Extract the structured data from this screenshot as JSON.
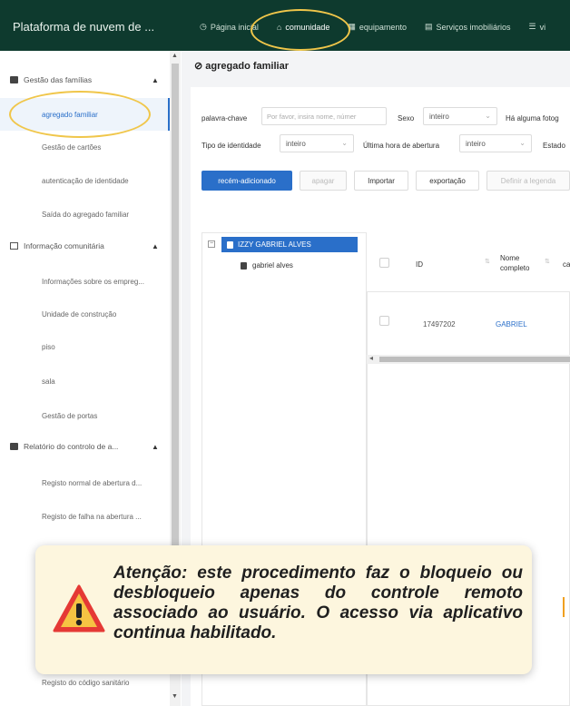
{
  "topbar": {
    "brand": "Plataforma de nuvem de ...",
    "nav": [
      {
        "label": "Página inicial",
        "icon": "clock-icon"
      },
      {
        "label": "comunidade",
        "icon": "home-icon"
      },
      {
        "label": "equipamento",
        "icon": "device-icon"
      },
      {
        "label": "Serviços imobiliários",
        "icon": "building-icon"
      },
      {
        "label": "vi",
        "icon": "list-icon"
      }
    ]
  },
  "sidebar": {
    "groups": [
      {
        "label": "Gestão das famílias",
        "icon": "family-icon"
      },
      {
        "label": "Informação comunitária",
        "icon": "house-icon"
      },
      {
        "label": "Relatório do controlo de a...",
        "icon": "report-icon"
      }
    ],
    "items": [
      "agregado familiar",
      "Gestão de cartões",
      "autenticação de identidade",
      "Saída do agregado familiar",
      "Informações sobre os empreg...",
      "Unidade de construção",
      "piso",
      "sala",
      "Gestão de portas",
      "Registo normal de abertura d...",
      "Registo de falha na abertura ...",
      "Registo do código sanitário"
    ]
  },
  "page": {
    "title": "agregado familiar"
  },
  "filters": {
    "keyword_label": "palavra-chave",
    "keyword_placeholder": "Por favor, insira nome, númer",
    "sex_label": "Sexo",
    "sex_value": "inteiro",
    "photo_label": "Há alguma fotog",
    "identity_label": "Tipo de identidade",
    "identity_value": "inteiro",
    "last_open_label": "Última hora de abertura",
    "last_open_value": "inteiro",
    "state_label": "Estado"
  },
  "toolbar": {
    "add": "recém-adicionado",
    "delete": "apagar",
    "import": "Importar",
    "export": "exportação",
    "caption": "Definir a legenda"
  },
  "tree": {
    "root": "IZZY GABRIEL ALVES",
    "child": "gabriel alves"
  },
  "table": {
    "headers": [
      "ID",
      "Nome completo",
      "ca"
    ],
    "rows": [
      {
        "id": "17497202",
        "name": "GABRIEL"
      }
    ]
  },
  "notice": {
    "text": "Atenção: este procedimento faz o bloqueio ou desbloqueio apenas do controle remoto associado ao usuário. O acesso via aplicativo continua habilitado."
  },
  "colors": {
    "topbar": "#0e3a2e",
    "accent": "#2a6fc9",
    "highlight": "#f0c64a",
    "notice_bg": "#fdf6de",
    "warning": "#e53935"
  }
}
